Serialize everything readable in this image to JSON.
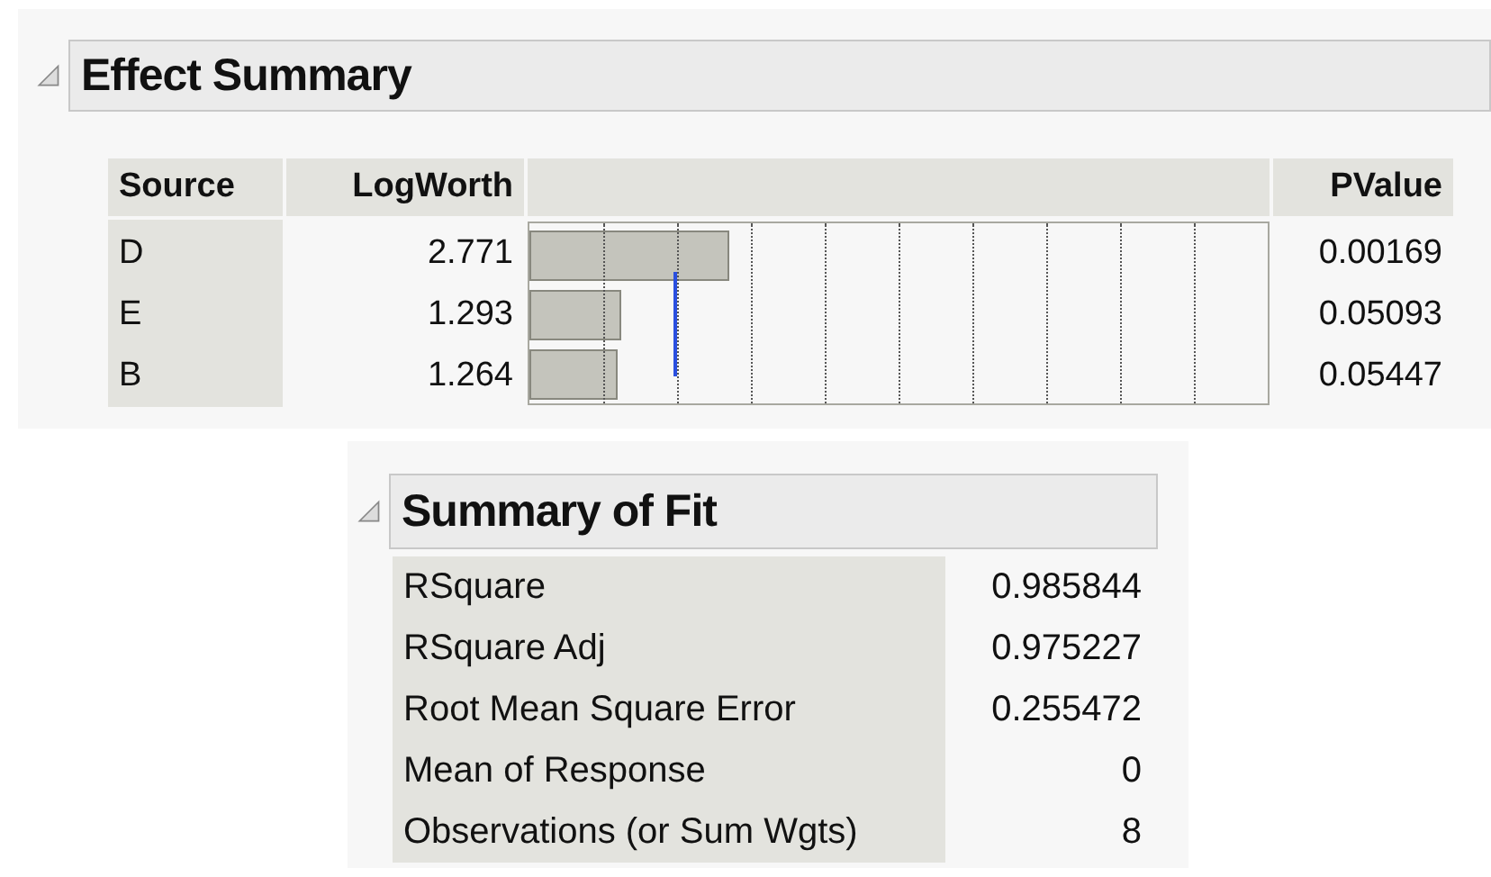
{
  "effect_summary": {
    "title": "Effect Summary",
    "expanded": true,
    "columns": [
      "Source",
      "LogWorth",
      "PValue"
    ],
    "rows": [
      {
        "source": "D",
        "logworth": "2.771",
        "level": 0.27,
        "pvalue": "0.00169"
      },
      {
        "source": "E",
        "logworth": "1.293",
        "level": 0.125,
        "pvalue": "0.05093"
      },
      {
        "source": "B",
        "logworth": "1.264",
        "level": 0.12,
        "pvalue": "0.05447"
      }
    ]
  },
  "summary_of_fit": {
    "title": "Summary of Fit",
    "expanded": true,
    "rows": [
      {
        "label": "RSquare",
        "value": "0.985844"
      },
      {
        "label": "RSquare Adj",
        "value": "0.975227"
      },
      {
        "label": "Root Mean Square Error",
        "value": "0.255472"
      },
      {
        "label": "Mean of Response",
        "value": "0"
      },
      {
        "label": "Observations (or Sum Wgts)",
        "value": "8"
      }
    ]
  }
}
